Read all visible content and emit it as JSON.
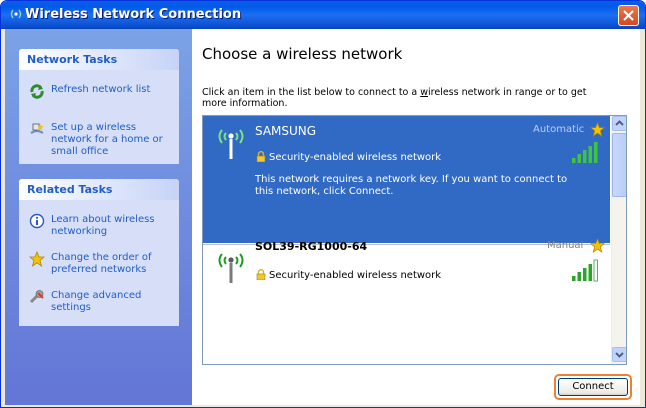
{
  "window": {
    "title": "Wireless Network Connection"
  },
  "sidebar": {
    "network_tasks": {
      "header": "Network Tasks",
      "items": [
        {
          "label": "Refresh network list",
          "icon": "refresh-icon"
        },
        {
          "label": "Set up a wireless network for a home or small office",
          "icon": "setup-wizard-icon"
        }
      ]
    },
    "related_tasks": {
      "header": "Related Tasks",
      "items": [
        {
          "label": "Learn about wireless networking",
          "icon": "info-icon"
        },
        {
          "label": "Change the order of preferred networks",
          "icon": "star-icon"
        },
        {
          "label": "Change advanced settings",
          "icon": "settings-icon"
        }
      ]
    }
  },
  "main": {
    "heading": "Choose a wireless network",
    "intro": "Click an item in the list below to connect to a wireless network in range or to get more information.",
    "intro_underlined_letter": "w",
    "networks": [
      {
        "name": "SAMSUNG",
        "mode": "Automatic",
        "security": "Security-enabled wireless network",
        "description": "This network requires a network key. If you want to connect to this network, click Connect.",
        "selected": true,
        "signal": "5 of 5 bars"
      },
      {
        "name": "SOL39-RG1000-64",
        "mode": "Manual",
        "security": "Security-enabled wireless network",
        "selected": false,
        "signal": "4 of 5 bars"
      }
    ],
    "connect_button": "Connect"
  },
  "colors": {
    "title_bar": "#0a5ee8",
    "sidebar": "#6375d6",
    "selection": "#316ac5",
    "link": "#215dc6",
    "highlight_outline": "#f07f2e"
  }
}
